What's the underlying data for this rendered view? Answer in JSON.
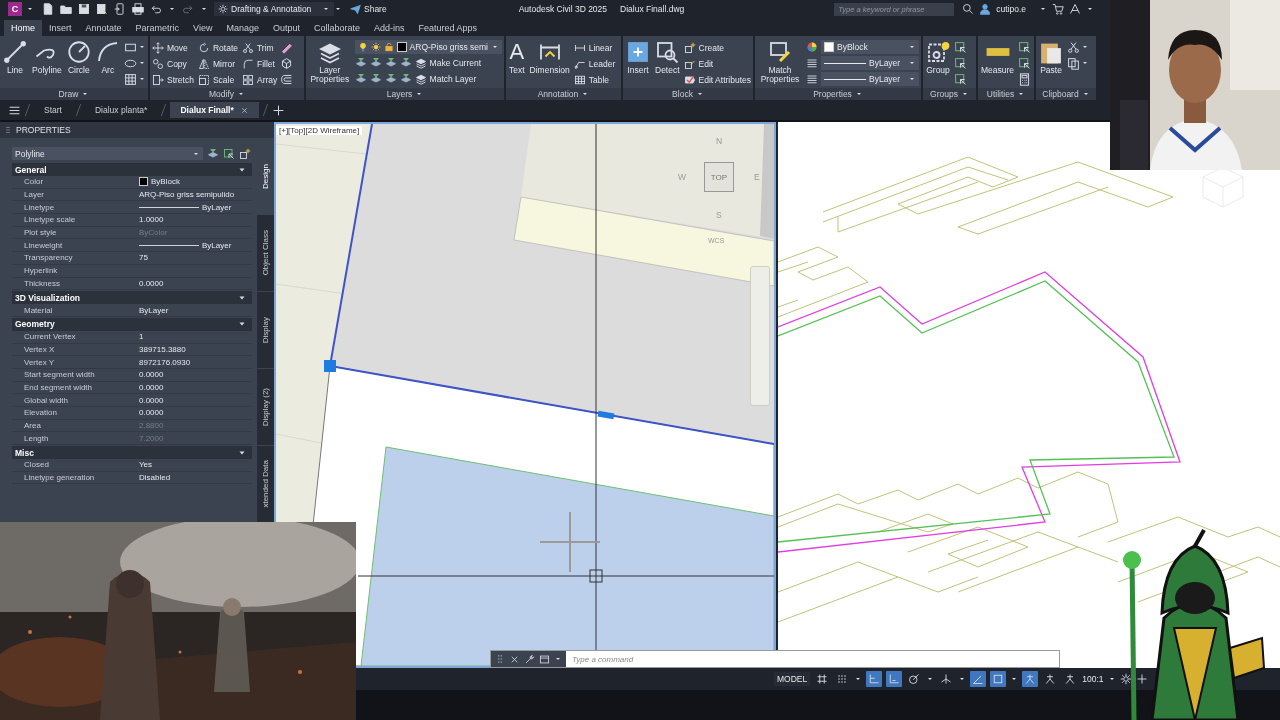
{
  "title_bar": {
    "app_letter": "C",
    "workspace": "Drafting & Annotation",
    "share": "Share",
    "title": "Autodesk Civil 3D 2025",
    "file": "Dialux Finall.dwg",
    "search": {
      "placeholder": "Type a keyword or phrase"
    },
    "user": "cutipo.e"
  },
  "ribbon_tabs": [
    {
      "label": "Home",
      "selected": true
    },
    {
      "label": "Insert",
      "selected": false
    },
    {
      "label": "Annotate",
      "selected": false
    },
    {
      "label": "Parametric",
      "selected": false
    },
    {
      "label": "View",
      "selected": false
    },
    {
      "label": "Manage",
      "selected": false
    },
    {
      "label": "Output",
      "selected": false
    },
    {
      "label": "Collaborate",
      "selected": false
    },
    {
      "label": "Add-ins",
      "selected": false
    },
    {
      "label": "Featured Apps",
      "selected": false
    }
  ],
  "ribbon_panels": [
    {
      "kind": "draw",
      "title": "Draw",
      "large": [
        {
          "label": "Line"
        },
        {
          "label": "Polyline"
        },
        {
          "label": "Circle"
        },
        {
          "label": "Arc"
        }
      ]
    },
    {
      "kind": "modify",
      "title": "Modify",
      "small": [
        "Move",
        "Copy",
        "Stretch",
        "Rotate",
        "Mirror",
        "Scale",
        "Trim",
        "Fillet",
        "Array"
      ]
    },
    {
      "kind": "layers",
      "title": "Layers",
      "large": [
        {
          "label": "Layer Properties"
        }
      ],
      "combo": "ARQ-Piso griss semi",
      "small": [
        "Make Current",
        "Match Layer"
      ]
    },
    {
      "kind": "annotation",
      "title": "Annotation",
      "large": [
        {
          "label": "Text",
          "glyph": "A"
        },
        {
          "label": "Dimension"
        }
      ],
      "small": [
        "Linear",
        "Leader",
        "Table"
      ]
    },
    {
      "kind": "block",
      "title": "Block",
      "large": [
        {
          "label": "Insert"
        },
        {
          "label": "Detect"
        }
      ],
      "small": [
        "Create",
        "Edit",
        "Edit Attributes"
      ]
    },
    {
      "kind": "properties",
      "title": "Properties",
      "large": [
        {
          "label": "Match Properties"
        }
      ],
      "combos": [
        {
          "kind": "color",
          "label": "ByBlock"
        },
        {
          "kind": "line",
          "label": "ByLayer"
        },
        {
          "kind": "line",
          "label": "ByLayer"
        }
      ]
    },
    {
      "kind": "groups",
      "title": "Groups",
      "large": [
        {
          "label": "Group"
        }
      ]
    },
    {
      "kind": "utilities",
      "title": "Utilities",
      "large": [
        {
          "label": "Measure"
        }
      ]
    },
    {
      "kind": "clipboard",
      "title": "Clipboard",
      "large": [
        {
          "label": "Paste"
        }
      ]
    }
  ],
  "file_tabs": [
    {
      "label": "Start",
      "selected": false
    },
    {
      "label": "Dialux planta*",
      "selected": false
    },
    {
      "label": "Dialux Finall*",
      "selected": true
    }
  ],
  "properties": {
    "title": "PROPERTIES",
    "object_type": "Polyline",
    "sections": [
      {
        "title": "General",
        "expanded": true,
        "rows": [
          {
            "label": "Color",
            "value": "ByBlock",
            "kind": "color",
            "disabled": false
          },
          {
            "label": "Layer",
            "value": "ARQ-Piso griss semipulido",
            "kind": "text",
            "disabled": false
          },
          {
            "label": "Linetype",
            "value": "ByLayer",
            "kind": "line",
            "disabled": false
          },
          {
            "label": "Linetype scale",
            "value": "1.0000",
            "kind": "text",
            "disabled": false
          },
          {
            "label": "Plot style",
            "value": "ByColor",
            "kind": "text",
            "disabled": true
          },
          {
            "label": "Lineweight",
            "value": "ByLayer",
            "kind": "line",
            "disabled": false
          },
          {
            "label": "Transparency",
            "value": "75",
            "kind": "text",
            "disabled": false
          },
          {
            "label": "Hyperlink",
            "disabled": false
          },
          {
            "label": "Thickness",
            "value": "0.0000",
            "kind": "text",
            "disabled": false
          }
        ]
      },
      {
        "title": "3D Visualization",
        "expanded": true,
        "rows": [
          {
            "label": "Material",
            "value": "ByLayer",
            "kind": "text",
            "disabled": false
          }
        ]
      },
      {
        "title": "Geometry",
        "expanded": true,
        "rows": [
          {
            "label": "Current Vertex",
            "value": "1",
            "kind": "text",
            "disabled": false
          },
          {
            "label": "Vertex X",
            "value": "389715.3880",
            "kind": "text",
            "disabled": false
          },
          {
            "label": "Vertex Y",
            "value": "8972176.0930",
            "kind": "text",
            "disabled": false
          },
          {
            "label": "Start segment width",
            "value": "0.0000",
            "kind": "text",
            "disabled": false
          },
          {
            "label": "End segment width",
            "value": "0.0000",
            "kind": "text",
            "disabled": false
          },
          {
            "label": "Global width",
            "value": "0.0000",
            "kind": "text",
            "disabled": false
          },
          {
            "label": "Elevation",
            "value": "0.0000",
            "kind": "text",
            "disabled": false
          },
          {
            "label": "Area",
            "value": "2.8800",
            "kind": "text",
            "disabled": true
          },
          {
            "label": "Length",
            "value": "7.2000",
            "kind": "text",
            "disabled": true
          }
        ]
      },
      {
        "title": "Misc",
        "expanded": true,
        "rows": [
          {
            "label": "Closed",
            "value": "Yes",
            "kind": "text",
            "disabled": false
          },
          {
            "label": "Linetype generation",
            "value": "Disabled",
            "kind": "text",
            "disabled": false
          }
        ]
      }
    ],
    "side_tabs": [
      {
        "label": "Design",
        "selected": true
      },
      {
        "label": "Object Class",
        "selected": false
      },
      {
        "label": "Display",
        "selected": false
      },
      {
        "label": "Display (2)",
        "selected": false
      },
      {
        "label": "xtended Data",
        "selected": false
      }
    ]
  },
  "viewport_left": {
    "label": "[+][Top][2D Wireframe]",
    "viewcube": {
      "north": "N",
      "west": "W",
      "top": "TOP",
      "east": "E",
      "south": "S",
      "ucs": "WCS"
    }
  },
  "command_line": {
    "placeholder": "Type a command"
  },
  "status_bar": {
    "model": "MODEL",
    "toggles": [
      {
        "on": false
      },
      {
        "on": false
      },
      {
        "on": true
      },
      {
        "on": true
      },
      {
        "on": false
      },
      {
        "on": false
      },
      {
        "on": true
      },
      {
        "on": true
      },
      {
        "on": true
      },
      {
        "on": false
      },
      {
        "on": false
      }
    ],
    "scale": "100:1"
  }
}
